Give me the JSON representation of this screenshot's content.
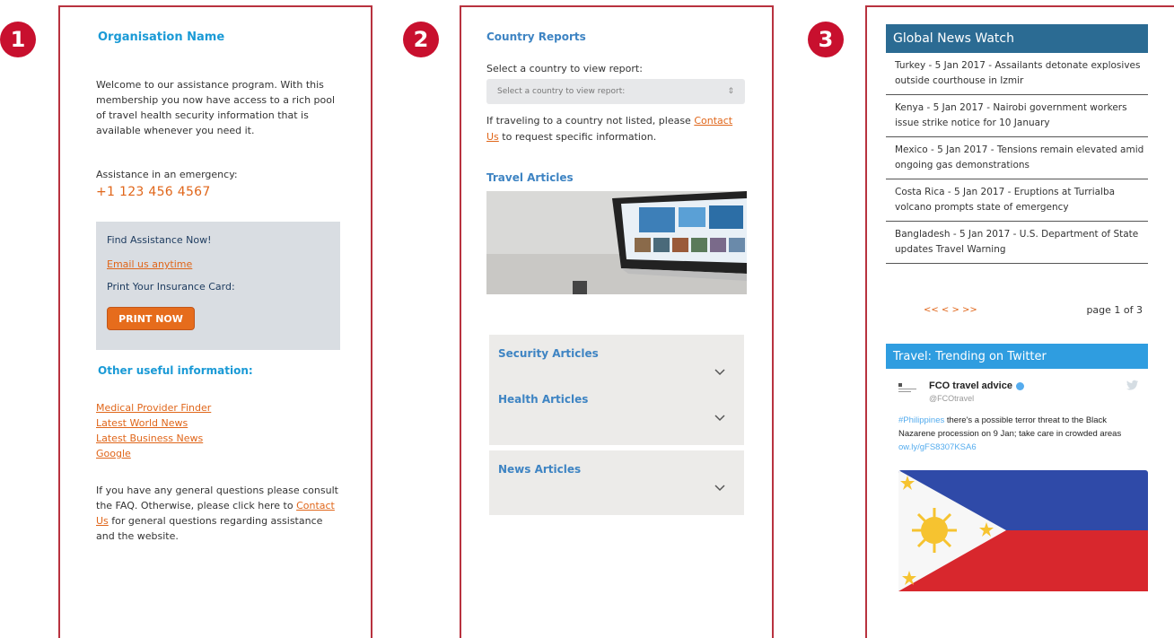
{
  "badges": [
    "1",
    "2",
    "3"
  ],
  "panel1": {
    "org_name": "Organisation Name",
    "welcome": "Welcome to our assistance program. With this membership you now have access to a rich pool of travel health security information that is available whenever you need it.",
    "assist_label": "Assistance in an emergency:",
    "phone": "+1 123 456 4567",
    "assist_box": {
      "title": "Find Assistance Now!",
      "email_link": "Email us anytime",
      "print_label": "Print Your Insurance Card:",
      "print_button": "PRINT NOW"
    },
    "useful_title": "Other useful information:",
    "links": [
      "Medical Provider Finder",
      "Latest World News",
      "Latest Business News",
      "Google"
    ],
    "general_before": "If you have any general questions please consult the FAQ. Otherwise, please click here to ",
    "general_link": "Contact Us",
    "general_after": " for general questions regarding assistance and the website."
  },
  "panel2": {
    "country_title": "Country Reports",
    "select_label": "Select a country to view report:",
    "select_placeholder": "Select a country to view report:",
    "notlisted_before": "If traveling to a country not listed, please ",
    "notlisted_link": "Contact Us",
    "notlisted_after": " to request specific information.",
    "travel_title": "Travel Articles",
    "accordions": [
      "Security Articles",
      "Health Articles",
      "News Articles"
    ]
  },
  "panel3": {
    "news_title": "Global News Watch",
    "news": [
      "Turkey - 5 Jan 2017 - Assailants detonate explosives outside courthouse in Izmir",
      "Kenya - 5 Jan 2017 - Nairobi government workers issue strike notice for 10 January",
      "Mexico - 5 Jan 2017 - Tensions remain elevated amid ongoing gas demonstrations",
      "Costa Rica - 5 Jan 2017 - Eruptions at Turrialba volcano prompts state of emergency",
      "Bangladesh - 5 Jan 2017 - U.S. Department of State updates Travel Warning"
    ],
    "pager_nav": "<< < > >>",
    "page": "page 1 of 3",
    "twitter_title": "Travel: Trending on Twitter",
    "tweet": {
      "name": "FCO travel advice",
      "handle": "@FCOtravel",
      "hashtag": "#Philippines",
      "text": " there's a possible terror threat to the Black Nazarene procession on 9 Jan; take care in crowded areas ",
      "link": "ow.ly/gFS8307KSA6"
    },
    "colors": {
      "header_dark": "#2b6b93",
      "header_light": "#2f9de0"
    }
  },
  "colors": {
    "accent_red": "#c8102e",
    "link_orange": "#e0661a",
    "heading_blue": "#1a9ad6"
  }
}
